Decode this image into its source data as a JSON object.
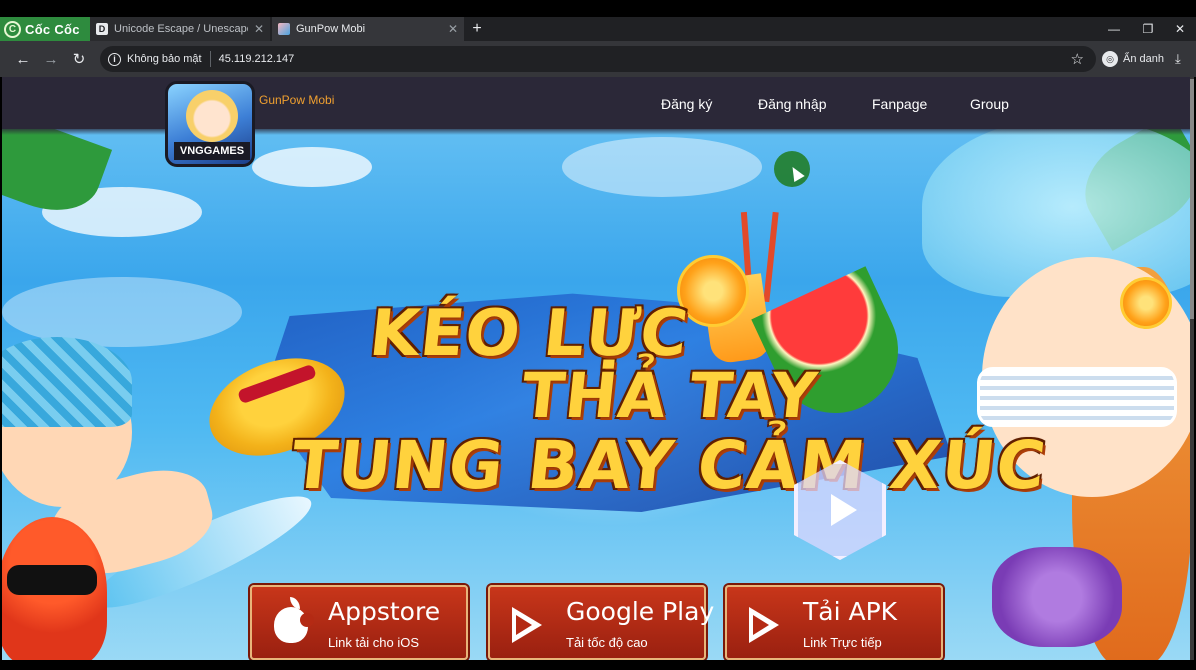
{
  "browser": {
    "brand_name": "Cốc Cốc",
    "tabs": [
      {
        "title": "Unicode Escape / Unescape (Enco",
        "favicon": "unicode-site-icon"
      },
      {
        "title": "GunPow Mobi",
        "favicon": "gunpow-game-icon"
      }
    ],
    "address": {
      "security_label": "Không bảo mật",
      "url": "45.119.212.147"
    },
    "incognito_label": "Ẩn danh"
  },
  "site": {
    "name": "GunPow Mobi",
    "logo_text": "VNGGAMES",
    "nav": [
      "Đăng ký",
      "Đăng nhập",
      "Fanpage",
      "Group"
    ],
    "hero_title": [
      "KÉO LỰC",
      "THẢ TAY",
      "TUNG BAY CẢM XÚC"
    ],
    "downloads": [
      {
        "title": "Appstore",
        "subtitle": "Link tải cho iOS",
        "icon": "apple-icon"
      },
      {
        "title": "Google Play",
        "subtitle": "Tải tốc độ cao",
        "icon": "google-play-icon"
      },
      {
        "title": "Tải APK",
        "subtitle": "Link Trực tiếp",
        "icon": "apk-play-icon"
      }
    ]
  },
  "colors": {
    "site_header": "#2b2838",
    "site_name": "#f0a030",
    "download_button": "#b42a14",
    "title_yellow": "#ffd23d"
  }
}
